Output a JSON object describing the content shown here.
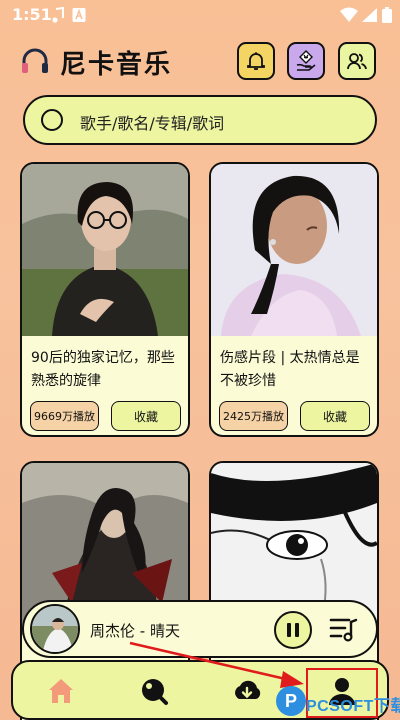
{
  "status_bar": {
    "time": "1:51",
    "icons": [
      "music-note-icon",
      "a-badge-icon",
      "wifi-icon",
      "signal-icon",
      "battery-icon"
    ]
  },
  "header": {
    "title": "尼卡音乐",
    "icons": [
      "headphones-logo",
      "bell-icon",
      "vip-icon",
      "friends-icon"
    ]
  },
  "search": {
    "placeholder": "歌手/歌名/专辑/歌词"
  },
  "playlists": [
    {
      "title": "90后的独家记忆，那些熟悉的旋律",
      "plays": "9669万播放",
      "collect_label": "收藏"
    },
    {
      "title": "伤感片段 | 太热情总是不被珍惜",
      "plays": "2425万播放",
      "collect_label": "收藏"
    },
    {
      "title": "",
      "plays": "",
      "collect_label": ""
    },
    {
      "title": "",
      "plays": "",
      "collect_label": ""
    }
  ],
  "player": {
    "song": "周杰伦 - 晴天",
    "state": "playing",
    "icons": [
      "pause-icon",
      "playlist-icon"
    ]
  },
  "bottom_nav": {
    "items": [
      "home-icon",
      "discover-icon",
      "download-icon",
      "profile-icon"
    ],
    "active": "profile"
  },
  "watermark": {
    "badge": "P",
    "text": "PCSOFT下载"
  },
  "colors": {
    "background": "#f7c29d",
    "accent_yellow": "#edf5a1",
    "bell_bg": "#f4d462",
    "vip_bg": "#c9a8ec",
    "plays_bg": "#f6d3a6",
    "home_icon": "#f29a7a",
    "annotation_red": "#e01b1b"
  }
}
